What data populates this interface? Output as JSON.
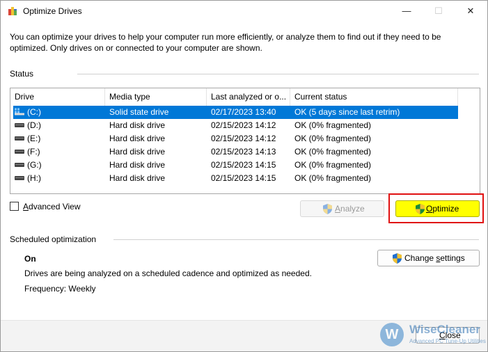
{
  "window": {
    "title": "Optimize Drives",
    "controls": {
      "minimize": "—",
      "maximize": "☐",
      "close": "✕"
    }
  },
  "description": "You can optimize your drives to help your computer run more efficiently, or analyze them to find out if they need to be optimized. Only drives on or connected to your computer are shown.",
  "status": {
    "label": "Status",
    "columns": [
      "Drive",
      "Media type",
      "Last analyzed or o...",
      "Current status"
    ],
    "rows": [
      {
        "drive": "(C:)",
        "media": "Solid state drive",
        "last": "02/17/2023 13:40",
        "status": "OK (5 days since last retrim)",
        "icon": "system-drive-icon",
        "selected": true
      },
      {
        "drive": "(D:)",
        "media": "Hard disk drive",
        "last": "02/15/2023 14:12",
        "status": "OK (0% fragmented)",
        "icon": "hard-disk-icon"
      },
      {
        "drive": "(E:)",
        "media": "Hard disk drive",
        "last": "02/15/2023 14:12",
        "status": "OK (0% fragmented)",
        "icon": "hard-disk-icon"
      },
      {
        "drive": "(F:)",
        "media": "Hard disk drive",
        "last": "02/15/2023 14:13",
        "status": "OK (0% fragmented)",
        "icon": "hard-disk-icon"
      },
      {
        "drive": "(G:)",
        "media": "Hard disk drive",
        "last": "02/15/2023 14:15",
        "status": "OK (0% fragmented)",
        "icon": "hard-disk-icon"
      },
      {
        "drive": "(H:)",
        "media": "Hard disk drive",
        "last": "02/15/2023 14:15",
        "status": "OK (0% fragmented)",
        "icon": "hard-disk-icon"
      }
    ]
  },
  "advanced_view": {
    "label_prefix": "",
    "label_mnemonic": "A",
    "label_rest": "dvanced View",
    "checked": false
  },
  "buttons": {
    "analyze": {
      "mnemonic": "A",
      "rest": "nalyze",
      "enabled": false
    },
    "optimize": {
      "mnemonic": "O",
      "rest": "ptimize",
      "enabled": true,
      "highlight": "#ffff00"
    },
    "change_settings": {
      "prefix": "Change ",
      "mnemonic": "s",
      "rest": "ettings"
    },
    "close": {
      "mnemonic": "C",
      "rest": "lose"
    }
  },
  "scheduled": {
    "label": "Scheduled optimization",
    "state": "On",
    "info": "Drives are being analyzed on a scheduled cadence and optimized as needed.",
    "frequency": "Frequency: Weekly"
  },
  "watermark": {
    "logo": "W",
    "name": "WiseCleaner",
    "tagline": "Advanced PC Tune-Up Utilities"
  },
  "colors": {
    "selection": "#0078d7",
    "highlight_border": "#e01010",
    "optimize_fill": "#ffff00"
  }
}
